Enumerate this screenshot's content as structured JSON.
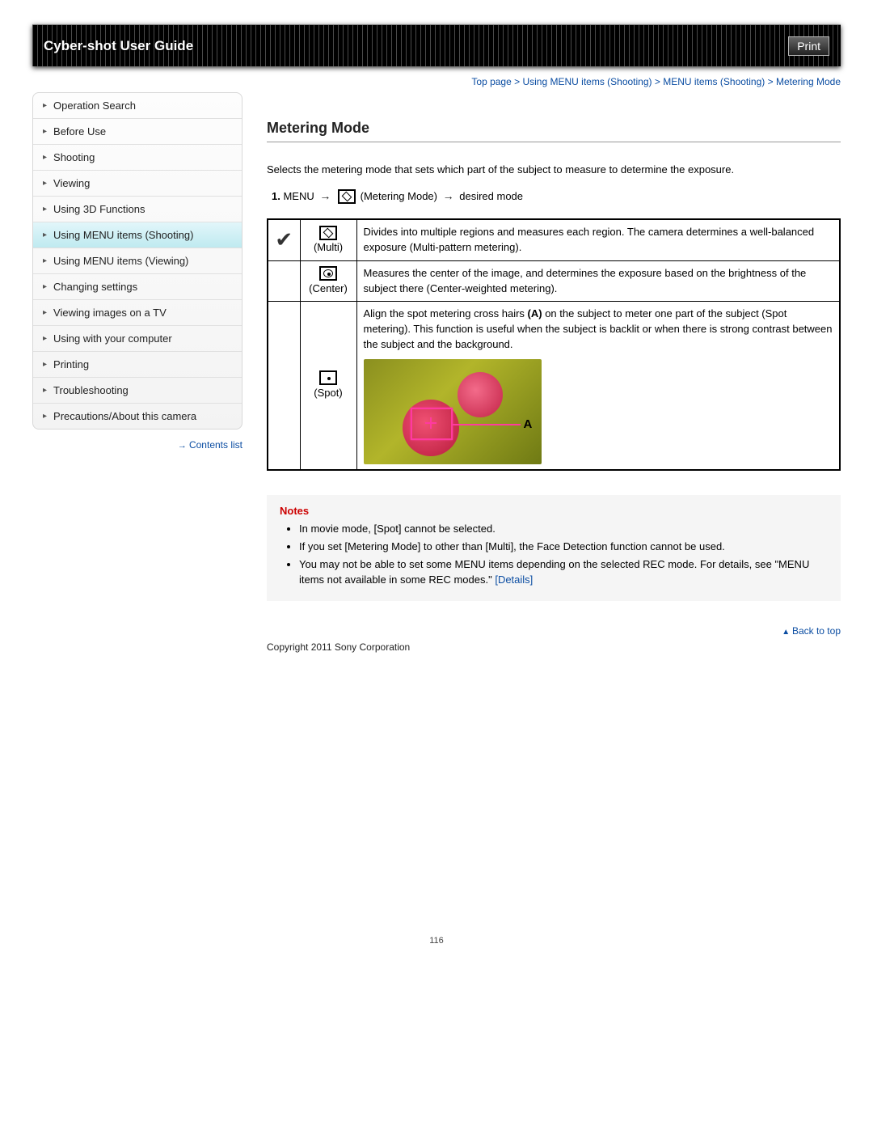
{
  "header": {
    "title": "Cyber-shot User Guide",
    "print_label": "Print"
  },
  "breadcrumb": {
    "items": [
      "Top page",
      "Using MENU items (Shooting)",
      "MENU items (Shooting)",
      "Metering Mode"
    ],
    "sep": " > "
  },
  "sidebar": {
    "items": [
      {
        "label": "Operation Search"
      },
      {
        "label": "Before Use"
      },
      {
        "label": "Shooting"
      },
      {
        "label": "Viewing"
      },
      {
        "label": "Using 3D Functions"
      },
      {
        "label": "Using MENU items (Shooting)",
        "active": true
      },
      {
        "label": "Using MENU items (Viewing)"
      },
      {
        "label": "Changing settings"
      },
      {
        "label": "Viewing images on a TV"
      },
      {
        "label": "Using with your computer"
      },
      {
        "label": "Printing"
      },
      {
        "label": "Troubleshooting"
      },
      {
        "label": "Precautions/About this camera"
      }
    ],
    "contents_list": "Contents list"
  },
  "main": {
    "title": "Metering Mode",
    "intro": "Selects the metering mode that sets which part of the subject to measure to determine the exposure.",
    "step": {
      "num": "1.",
      "menu": "MENU",
      "metering": "(Metering Mode)",
      "desired": "desired mode"
    },
    "table": {
      "multi": {
        "label": "(Multi)",
        "desc": "Divides into multiple regions and measures each region. The camera determines a well-balanced exposure (Multi-pattern metering)."
      },
      "center": {
        "label": "(Center)",
        "desc": "Measures the center of the image, and determines the exposure based on the brightness of the subject there (Center-weighted metering)."
      },
      "spot": {
        "label": "(Spot)",
        "desc_pre": "Align the spot metering cross hairs ",
        "desc_bold": "(A)",
        "desc_post": " on the subject to meter one part of the subject (Spot metering). This function is useful when the subject is backlit or when there is strong contrast between the subject and the background.",
        "pointer": "A"
      }
    },
    "notes": {
      "title": "Notes",
      "items": [
        "In movie mode, [Spot] cannot be selected.",
        "If you set [Metering Mode] to other than [Multi], the Face Detection function cannot be used.",
        "You may not be able to set some MENU items depending on the selected REC mode. For details, see \"MENU items not available in some REC modes.\" "
      ],
      "details": "[Details]"
    },
    "back_to_top": "Back to top",
    "copyright": "Copyright 2011 Sony Corporation"
  },
  "page_number": "116"
}
